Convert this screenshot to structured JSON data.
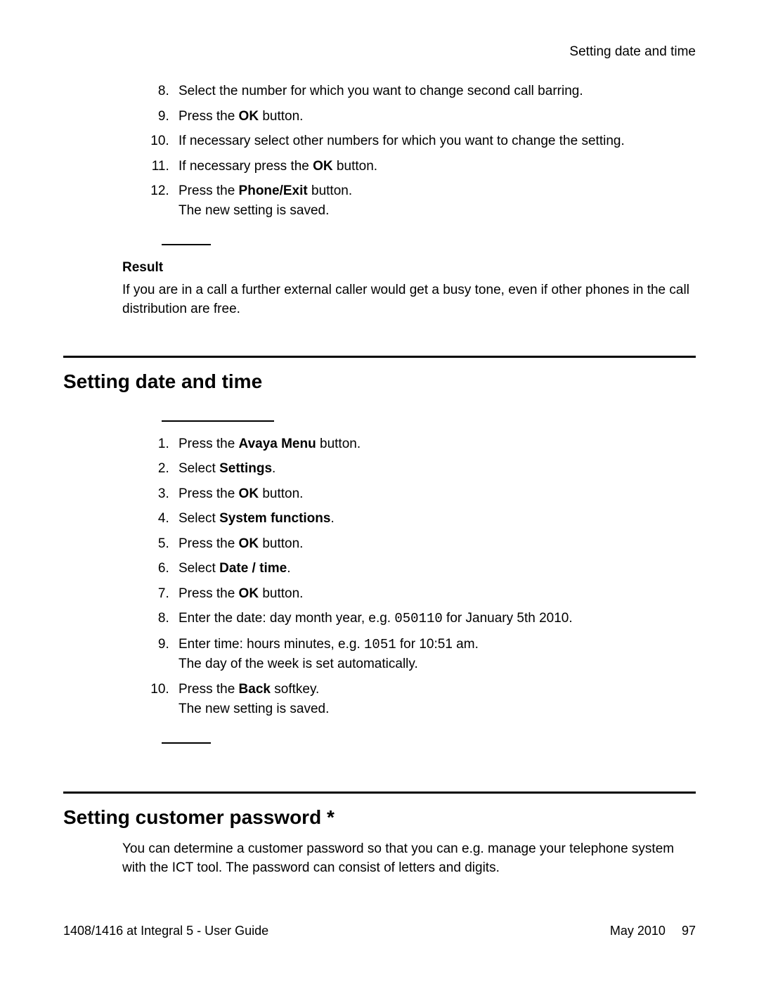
{
  "running_head": "Setting date and time",
  "first_list": {
    "start": 8,
    "items": [
      {
        "pre": "Select the number for which you want to change second call barring."
      },
      {
        "pre": "Press the ",
        "bold": "OK",
        "post": " button."
      },
      {
        "pre": "If necessary select other numbers for which you want to change the setting."
      },
      {
        "pre": "If necessary press the ",
        "bold": "OK",
        "post": " button."
      },
      {
        "pre": "Press the ",
        "bold": "Phone/Exit",
        "post": " button.",
        "sub": "The new setting is saved."
      }
    ]
  },
  "result": {
    "heading": "Result",
    "text": "If you are in a call a further external caller would get a busy tone, even if other phones in the call distribution are free."
  },
  "section1": {
    "title": "Setting date and time",
    "items": [
      {
        "pre": "Press the ",
        "bold": "Avaya Menu",
        "post": " button."
      },
      {
        "pre": "Select ",
        "bold": "Settings",
        "post": "."
      },
      {
        "pre": "Press the ",
        "bold": "OK",
        "post": " button."
      },
      {
        "pre": "Select ",
        "bold": "System functions",
        "post": "."
      },
      {
        "pre": "Press the ",
        "bold": "OK",
        "post": " button."
      },
      {
        "pre": "Select ",
        "bold": "Date / time",
        "post": "."
      },
      {
        "pre": "Press the ",
        "bold": "OK",
        "post": " button."
      },
      {
        "pre": "Enter the date: day month year, e.g. ",
        "code": "050110",
        "post": " for January 5th 2010."
      },
      {
        "pre": "Enter time: hours minutes, e.g. ",
        "code": "1051",
        "post": " for 10:51 am.",
        "sub": "The day of the week is set automatically."
      },
      {
        "pre": "Press the ",
        "bold": "Back",
        "post": " softkey.",
        "sub": "The new setting is saved."
      }
    ]
  },
  "section2": {
    "title": "Setting customer password *",
    "intro": "You can determine a customer password so that you can e.g. manage your telephone system with the ICT tool. The password can consist of letters and digits."
  },
  "footer": {
    "left": "1408/1416 at Integral 5 - User Guide",
    "date": "May 2010",
    "page": "97"
  }
}
